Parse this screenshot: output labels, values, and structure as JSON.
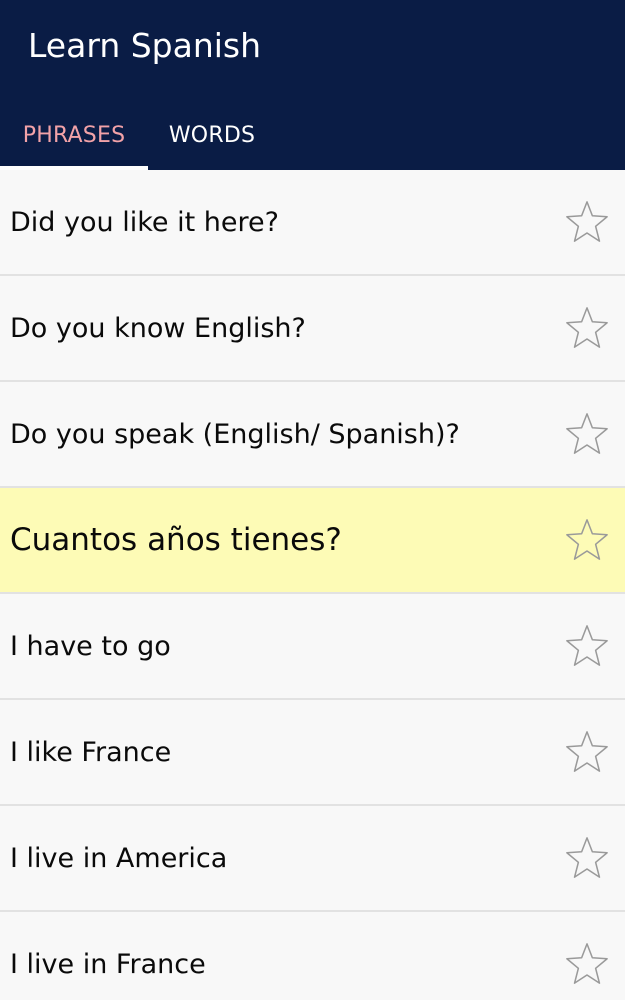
{
  "app": {
    "title": "Learn Spanish"
  },
  "tabs": [
    {
      "label": "PHRASES",
      "active": true
    },
    {
      "label": "WORDS",
      "active": false
    }
  ],
  "colors": {
    "appbar": "#0a1c45",
    "active_tab_text": "#f2a2a8",
    "highlight_row": "#fdfbb6"
  },
  "phrases": [
    {
      "text": "Did you like it here?",
      "icon": "star-outline-icon",
      "favorite": false
    },
    {
      "text": "Do you know English?",
      "icon": "star-outline-icon",
      "favorite": false
    },
    {
      "text": "Do you speak (English/ Spanish)?",
      "icon": "star-outline-icon",
      "favorite": false
    },
    {
      "text": "Cuantos años tienes?",
      "icon": "star-outline-icon",
      "favorite": false,
      "highlighted": true
    },
    {
      "text": "I have to go",
      "icon": "star-outline-icon",
      "favorite": false
    },
    {
      "text": "I like France",
      "icon": "star-outline-icon",
      "favorite": false
    },
    {
      "text": "I live in America",
      "icon": "star-outline-icon",
      "favorite": false
    },
    {
      "text": "I live in France",
      "icon": "star-outline-icon",
      "favorite": false
    }
  ]
}
